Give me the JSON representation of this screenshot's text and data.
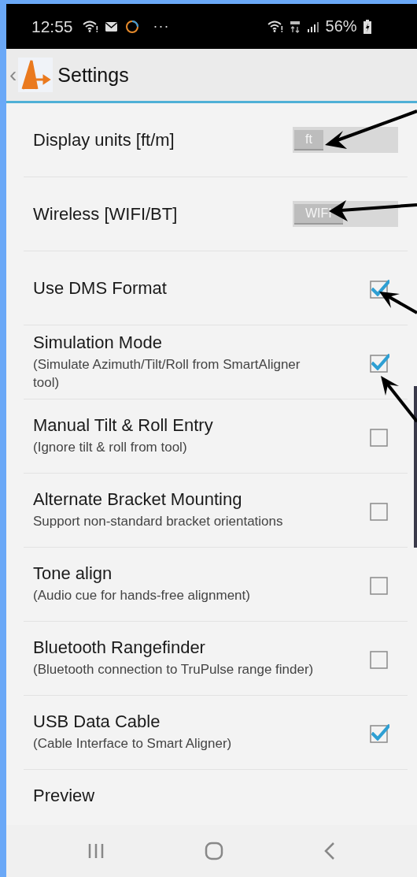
{
  "status_bar": {
    "time": "12:55",
    "more": "···",
    "battery": "56%"
  },
  "header": {
    "back": "‹",
    "title": "Settings"
  },
  "settings": [
    {
      "kind": "toggle",
      "title": "Display units [ft/m]",
      "value": "ft",
      "on": false
    },
    {
      "kind": "toggle",
      "title": "Wireless [WIFI/BT]",
      "value": "WIFI",
      "on": false
    },
    {
      "kind": "checkbox",
      "title": "Use DMS Format",
      "checked": true
    },
    {
      "kind": "checkbox",
      "title": "Simulation Mode",
      "summary": "(Simulate Azimuth/Tilt/Roll from SmartAligner tool)",
      "checked": true
    },
    {
      "kind": "checkbox",
      "title": "Manual Tilt & Roll Entry",
      "summary": "(Ignore tilt & roll from tool)",
      "checked": false
    },
    {
      "kind": "checkbox",
      "title": "Alternate Bracket Mounting",
      "summary": "Support non-standard bracket orientations",
      "checked": false
    },
    {
      "kind": "checkbox",
      "title": "Tone align",
      "summary": "(Audio cue for hands-free alignment)",
      "checked": false
    },
    {
      "kind": "checkbox",
      "title": "Bluetooth Rangefinder",
      "summary": "(Bluetooth connection to TruPulse range finder)",
      "checked": false
    },
    {
      "kind": "checkbox",
      "title": "USB Data Cable",
      "summary": "(Cable Interface to Smart Aligner)",
      "checked": true
    },
    {
      "kind": "heading",
      "title": "Preview"
    }
  ]
}
